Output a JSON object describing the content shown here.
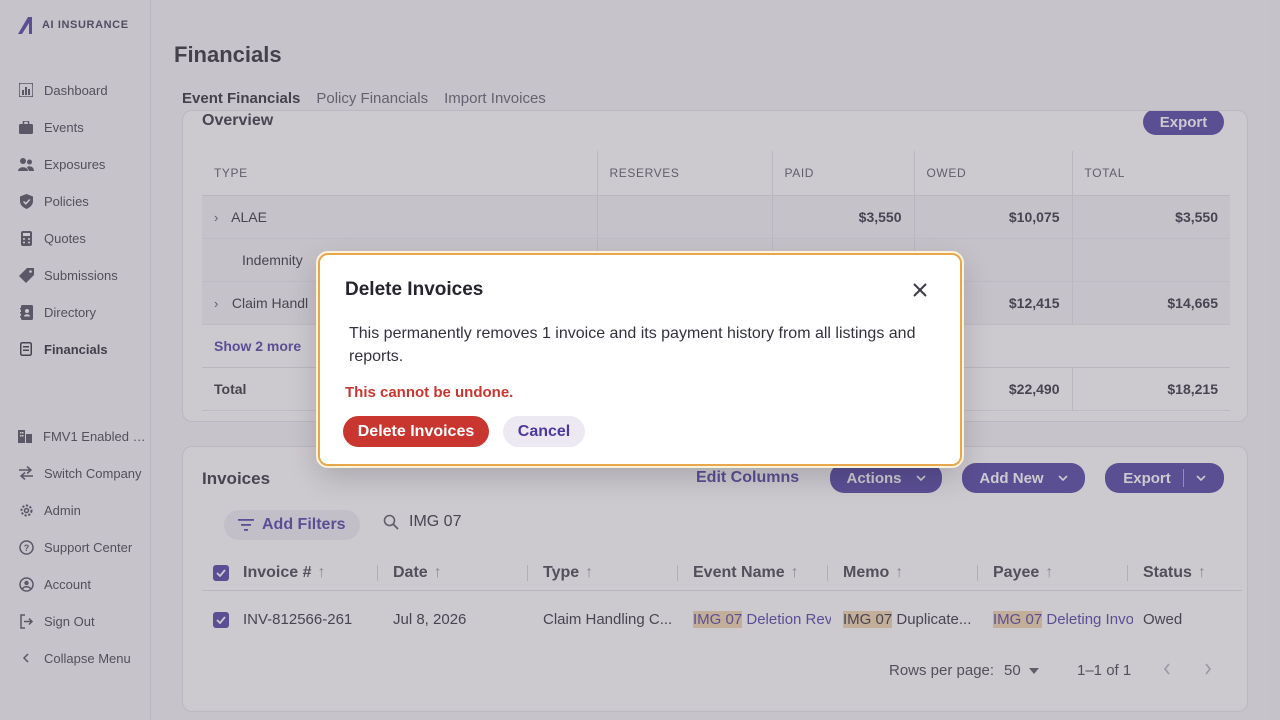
{
  "brand": {
    "name": "AI INSURANCE"
  },
  "sidebar": {
    "items": [
      {
        "label": "Dashboard",
        "icon": "bar-chart-icon"
      },
      {
        "label": "Events",
        "icon": "briefcase-icon"
      },
      {
        "label": "Exposures",
        "icon": "people-icon"
      },
      {
        "label": "Policies",
        "icon": "shield-icon"
      },
      {
        "label": "Quotes",
        "icon": "calculator-icon"
      },
      {
        "label": "Submissions",
        "icon": "tag-icon"
      },
      {
        "label": "Directory",
        "icon": "contacts-icon"
      },
      {
        "label": "Financials",
        "icon": "receipt-icon",
        "active": true
      }
    ],
    "bottom": [
      {
        "label": "FMV1 Enabled …",
        "icon": "building-icon"
      },
      {
        "label": "Switch Company",
        "icon": "switch-icon"
      },
      {
        "label": "Admin",
        "icon": "gear-icon"
      },
      {
        "label": "Support Center",
        "icon": "help-icon"
      },
      {
        "label": "Account",
        "icon": "account-icon"
      },
      {
        "label": "Sign Out",
        "icon": "sign-out-icon"
      },
      {
        "label": "Collapse Menu",
        "icon": "chevron-left-icon"
      }
    ]
  },
  "page": {
    "title": "Financials",
    "tabs": [
      "Event Financials",
      "Policy Financials",
      "Import Invoices"
    ]
  },
  "overview": {
    "title": "Overview",
    "export_label": "Export",
    "columns": [
      "TYPE",
      "RESERVES",
      "PAID",
      "OWED",
      "TOTAL"
    ],
    "rows": [
      {
        "type": "ALAE",
        "reserves": "",
        "paid": "$3,550",
        "owed": "$10,075",
        "total": "$3,550"
      },
      {
        "type": "Indemnity",
        "reserves": "",
        "paid": "",
        "owed": "",
        "total": ""
      },
      {
        "type": "Claim Handl",
        "reserves": "",
        "paid": "",
        "owed": "$12,415",
        "total": "$14,665"
      }
    ],
    "show_more": "Show 2 more",
    "total": {
      "label": "Total",
      "owed": "$22,490",
      "total": "$18,215"
    }
  },
  "invoices": {
    "title": "Invoices",
    "edit_columns": "Edit Columns",
    "actions": "Actions",
    "add_new": "Add New",
    "export": "Export",
    "add_filters": "Add Filters",
    "search_value": "IMG 07",
    "columns": [
      "Invoice #",
      "Date",
      "Type",
      "Event Name",
      "Memo",
      "Payee",
      "Status"
    ],
    "row": {
      "invoice": "INV-812566-261",
      "date": "Jul 8, 2026",
      "type": "Claim Handling C...",
      "event_hl": "IMG 07",
      "event_rest": " Deletion Revie",
      "memo_hl": "IMG 07",
      "memo_rest": " Duplicate...",
      "payee_hl": "IMG 07",
      "payee_rest": " Deleting Invoi",
      "status": "Owed"
    },
    "rows_per_page_label": "Rows per page:",
    "rows_per_page": "50",
    "range": "1–1 of 1"
  },
  "modal": {
    "title": "Delete Invoices",
    "body": "This permanently removes 1 invoice and its payment history from all listings and reports.",
    "warning": "This cannot be undone.",
    "confirm": "Delete Invoices",
    "cancel": "Cancel"
  },
  "colors": {
    "accent": "#4a3aa0",
    "danger": "#c9362f",
    "focus": "#e7a84d"
  }
}
